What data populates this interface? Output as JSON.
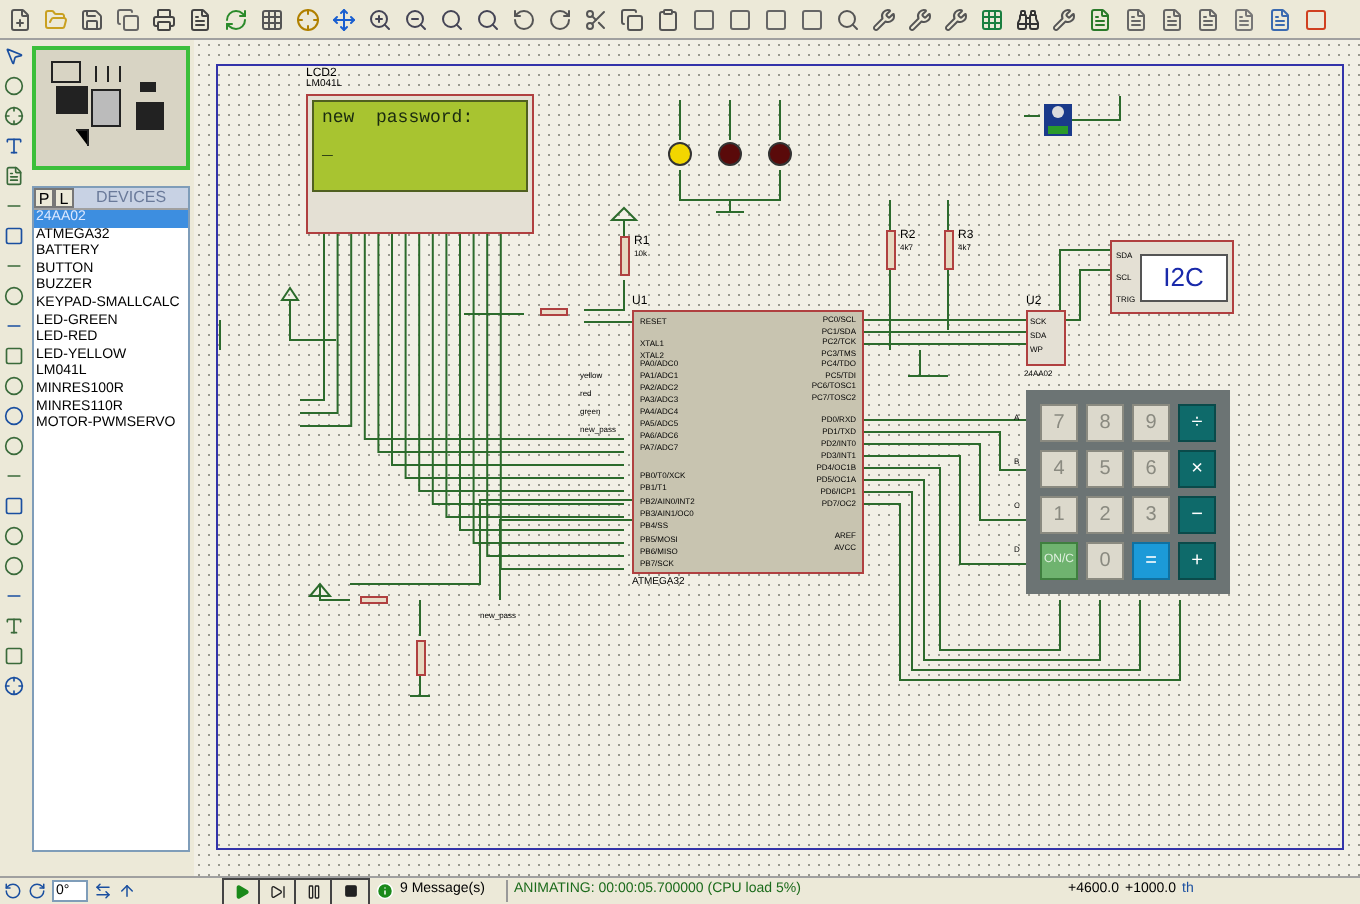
{
  "devices": {
    "tabs": [
      {
        "label": "P",
        "selected": false
      },
      {
        "label": "L",
        "selected": false
      }
    ],
    "title": "DEVICES",
    "items": [
      {
        "name": "24AA02",
        "selected": true
      },
      {
        "name": "ATMEGA32",
        "selected": false
      },
      {
        "name": "BATTERY",
        "selected": false
      },
      {
        "name": "BUTTON",
        "selected": false
      },
      {
        "name": "BUZZER",
        "selected": false
      },
      {
        "name": "KEYPAD-SMALLCALC",
        "selected": false
      },
      {
        "name": "LED-GREEN",
        "selected": false
      },
      {
        "name": "LED-RED",
        "selected": false
      },
      {
        "name": "LED-YELLOW",
        "selected": false
      },
      {
        "name": "LM041L",
        "selected": false
      },
      {
        "name": "MINRES100R",
        "selected": false
      },
      {
        "name": "MINRES110R",
        "selected": false
      },
      {
        "name": "MOTOR-PWMSERVO",
        "selected": false
      }
    ]
  },
  "schematic": {
    "lcd": {
      "ref": "LCD2",
      "part": "LM041L",
      "lines": [
        "new  password:",
        "_"
      ]
    },
    "leds": [
      {
        "color": "#f2d600"
      },
      {
        "color": "#5a0a0a"
      },
      {
        "color": "#5a0a0a"
      }
    ],
    "resistors": [
      {
        "ref": "R1",
        "value": "10k"
      },
      {
        "ref": "R2",
        "value": "4k7"
      },
      {
        "ref": "R3",
        "value": "4k7"
      }
    ],
    "mcu": {
      "ref": "U1",
      "part": "ATMEGA32",
      "left_pins": [
        "RESET",
        "XTAL1",
        "XTAL2",
        "PA0/ADC0",
        "PA1/ADC1",
        "PA2/ADC2",
        "PA3/ADC3",
        "PA4/ADC4",
        "PA5/ADC5",
        "PA6/ADC6",
        "PA7/ADC7",
        "PB0/T0/XCK",
        "PB1/T1",
        "PB2/AIN0/INT2",
        "PB3/AIN1/OC0",
        "PB4/SS",
        "PB5/MOSI",
        "PB6/MISO",
        "PB7/SCK"
      ],
      "right_pins": [
        "PC0/SCL",
        "PC1/SDA",
        "PC2/TCK",
        "PC3/TMS",
        "PC4/TDO",
        "PC5/TDI",
        "PC6/TOSC1",
        "PC7/TOSC2",
        "PD0/RXD",
        "PD1/TXD",
        "PD2/INT0",
        "PD3/INT1",
        "PD4/OC1B",
        "PD5/OC1A",
        "PD6/ICP1",
        "PD7/OC2",
        "AREF",
        "AVCC"
      ]
    },
    "eeprom": {
      "ref": "U2",
      "part": "24AA02",
      "pins": [
        "SCK",
        "SDA",
        "WP"
      ]
    },
    "i2c": {
      "label": "I2C",
      "pins": [
        "SDA",
        "SCL",
        "TRIG"
      ]
    },
    "net_labels": [
      "yellow",
      "red",
      "green",
      "new_pass"
    ],
    "bottom_label": "new_pass",
    "keypad": {
      "rows": [
        "A",
        "B",
        "C",
        "D"
      ],
      "keys": [
        {
          "label": "7",
          "kind": "digit"
        },
        {
          "label": "8",
          "kind": "digit"
        },
        {
          "label": "9",
          "kind": "digit"
        },
        {
          "label": "÷",
          "kind": "op"
        },
        {
          "label": "4",
          "kind": "digit"
        },
        {
          "label": "5",
          "kind": "digit"
        },
        {
          "label": "6",
          "kind": "digit"
        },
        {
          "label": "×",
          "kind": "op"
        },
        {
          "label": "1",
          "kind": "digit"
        },
        {
          "label": "2",
          "kind": "digit"
        },
        {
          "label": "3",
          "kind": "digit"
        },
        {
          "label": "−",
          "kind": "op"
        },
        {
          "label": "ON/C",
          "kind": "clear"
        },
        {
          "label": "0",
          "kind": "digit"
        },
        {
          "label": "=",
          "kind": "equals"
        },
        {
          "label": "+",
          "kind": "op"
        }
      ]
    }
  },
  "status_bar": {
    "rotation": "0°",
    "messages": "9 Message(s)",
    "status": "ANIMATING: 00:00:05.700000 (CPU load 5%)",
    "x": "+4600.0",
    "y": "+1000.0",
    "unit": "th"
  }
}
